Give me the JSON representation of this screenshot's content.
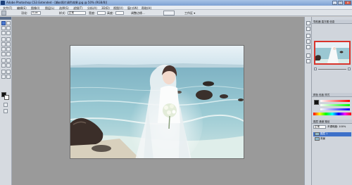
{
  "window": {
    "title": "Adobe Photoshop CS3 Extended - [婚纱照片调色效果.jpg @ 50% (RGB/8)]",
    "btn_min": "_",
    "btn_max": "□",
    "btn_close": "×"
  },
  "menu": [
    "文件(F)",
    "编辑(E)",
    "图像(I)",
    "图层(L)",
    "选择(S)",
    "滤镜(T)",
    "分析(A)",
    "3D(D)",
    "视图(V)",
    "窗口(W)",
    "帮助(H)"
  ],
  "options": {
    "feather_label": "羽化:",
    "feather_value": "0 px",
    "style_label": "样式:",
    "style_value": "正常",
    "width_label": "宽度:",
    "height_label": "高度:",
    "refine_label": "调整边缘...",
    "workspace_label": "工作区 ▾"
  },
  "panels": {
    "navigator_tab": "导航器  直方图  信息",
    "color_tab": "颜色  色板  样式",
    "layers_tab": "图层  通道  路径",
    "blend_mode": "正常",
    "opacity": "不透明度: 100%",
    "layers": [
      {
        "name": "图层 1"
      },
      {
        "name": "背景"
      }
    ]
  },
  "colors": {
    "accent": "#3d70c9",
    "foreground": "#111111",
    "background": "#ffffff"
  }
}
